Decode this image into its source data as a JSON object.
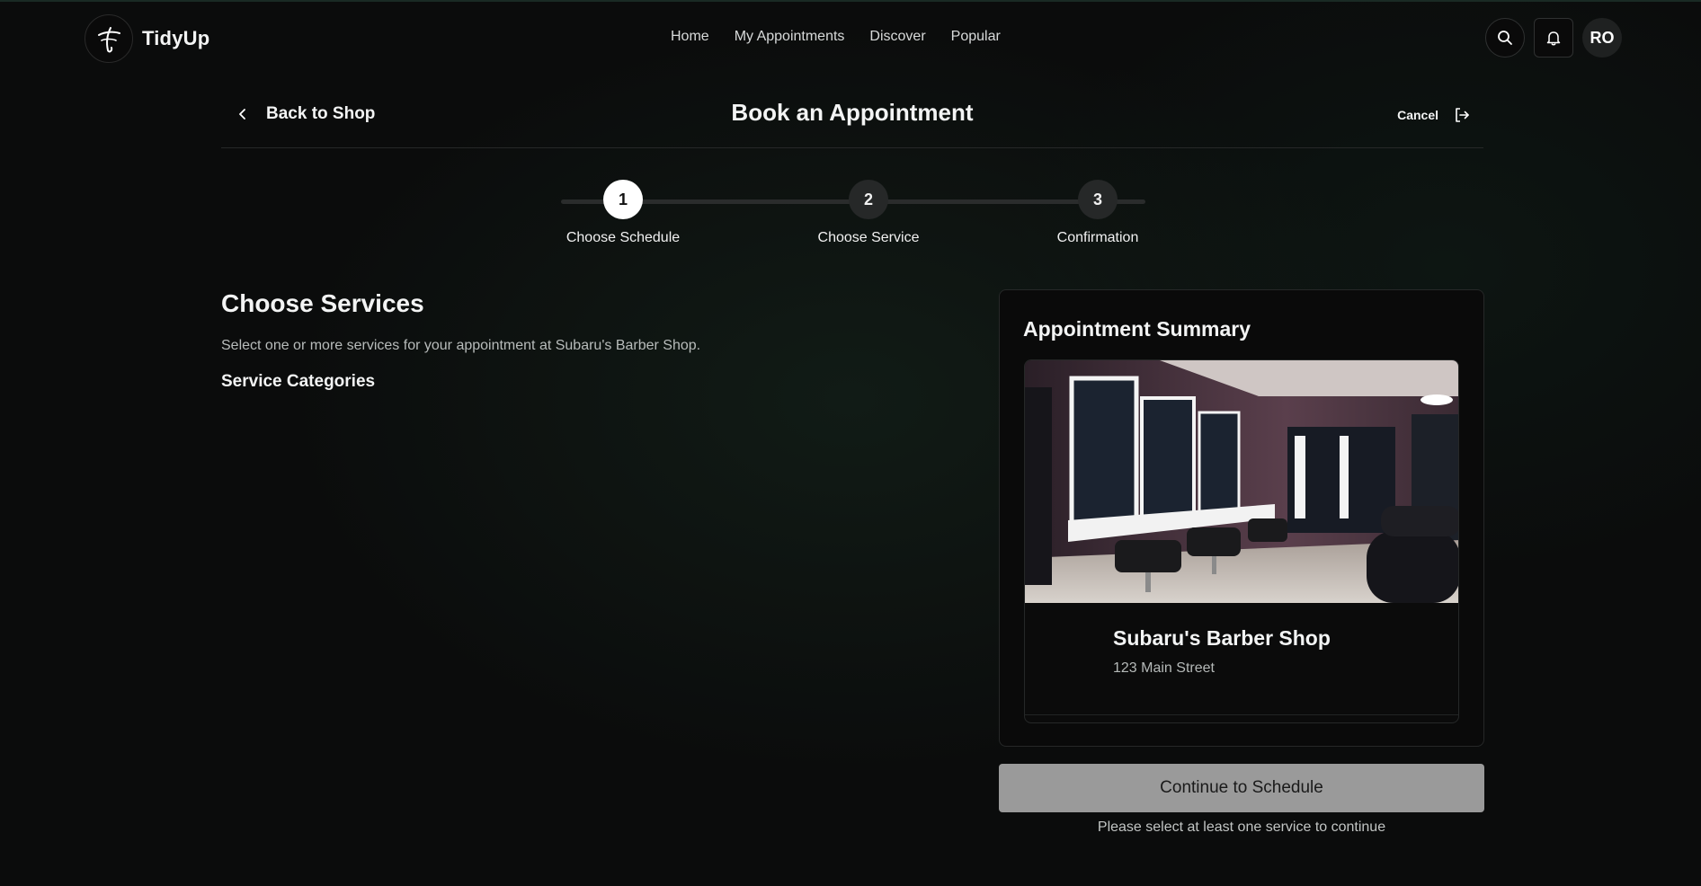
{
  "brand": {
    "name": "TidyUp",
    "logo_icon": "tidyup-logo-icon"
  },
  "nav": {
    "items": [
      "Home",
      "My Appointments",
      "Discover",
      "Popular"
    ]
  },
  "top_actions": {
    "search_icon": "search-icon",
    "bell_icon": "bell-icon",
    "avatar_initials": "RO"
  },
  "header": {
    "back_label": "Back to Shop",
    "title": "Book an Appointment",
    "cancel_label": "Cancel"
  },
  "stepper": {
    "current": 1,
    "steps": [
      {
        "number": "1",
        "label": "Choose Schedule"
      },
      {
        "number": "2",
        "label": "Choose Service"
      },
      {
        "number": "3",
        "label": "Confirmation"
      }
    ]
  },
  "services": {
    "title": "Choose Services",
    "description": "Select one or more services for your appointment at Subaru's Barber Shop.",
    "categories_title": "Service Categories"
  },
  "summary": {
    "title": "Appointment Summary",
    "shop_name": "Subaru's Barber Shop",
    "shop_address": "123 Main Street"
  },
  "actions": {
    "continue_label": "Continue to Schedule",
    "hint": "Please select at least one service to continue"
  },
  "colors": {
    "background": "#0b0c0c",
    "button_disabled": "#9a9a9a",
    "active_step": "#ffffff"
  }
}
